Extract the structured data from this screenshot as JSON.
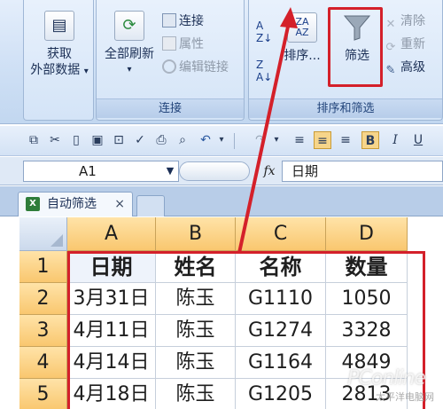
{
  "ribbon": {
    "get_external_data": {
      "line1": "获取",
      "line2": "外部数据",
      "arrow": "▾"
    },
    "refresh_all": {
      "label": "全部刷新",
      "arrow": "▾"
    },
    "connections": {
      "label": "连接"
    },
    "properties": {
      "label": "属性"
    },
    "edit_links": {
      "label": "编辑链接"
    },
    "connections_group_label": "连接",
    "sort": {
      "label": "排序..."
    },
    "filter": {
      "label": "筛选"
    },
    "clear": {
      "label": "清除"
    },
    "reapply": {
      "label": "重新"
    },
    "advanced": {
      "label": "高级"
    },
    "sort_filter_group_label": "排序和筛选"
  },
  "formula_bar": {
    "name_box": "A1",
    "fx": "fx",
    "content": "日期"
  },
  "workbook_tab": {
    "label": "自动筛选",
    "close": "×"
  },
  "grid": {
    "columns": [
      "A",
      "B",
      "C",
      "D"
    ],
    "rows": [
      {
        "num": "1",
        "cells": [
          "日期",
          "姓名",
          "名称",
          "数量"
        ]
      },
      {
        "num": "2",
        "cells": [
          "3月31日",
          "陈玉",
          "G1110",
          "1050"
        ]
      },
      {
        "num": "3",
        "cells": [
          "4月11日",
          "陈玉",
          "G1274",
          "3328"
        ]
      },
      {
        "num": "4",
        "cells": [
          "4月14日",
          "陈玉",
          "G1164",
          "4849"
        ]
      },
      {
        "num": "5",
        "cells": [
          "4月18日",
          "陈玉",
          "G1205",
          "2813"
        ]
      }
    ]
  },
  "watermark": {
    "brand": "PConline",
    "sub": "太平洋电脑网"
  },
  "colors": {
    "highlight": "#d4202a",
    "header_fill": "#f9c76f"
  }
}
